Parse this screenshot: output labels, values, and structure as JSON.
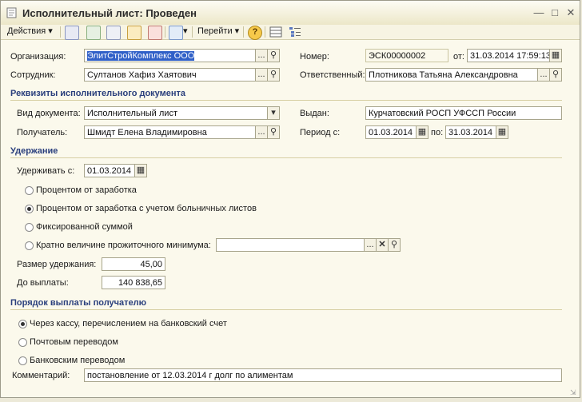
{
  "window": {
    "title": "Исполнительный лист: Проведен"
  },
  "toolbar": {
    "actions_label": "Действия",
    "goto_label": "Перейти",
    "icons": [
      "list-icon",
      "refresh-icon",
      "copy-icon",
      "post-icon",
      "unpost-icon",
      "move-icon",
      "help-icon",
      "table-icon",
      "structure-icon"
    ]
  },
  "header": {
    "org_label": "Организация:",
    "org_value": "ЭлитСтройКомплекс ООО",
    "employee_label": "Сотрудник:",
    "employee_value": "Султанов Хафиз Хаятович",
    "number_label": "Номер:",
    "number_value": "ЭСК00000002",
    "date_label": "от:",
    "date_value": "31.03.2014 17:59:13",
    "responsible_label": "Ответственный:",
    "responsible_value": "Плотникова Татьяна Александровна"
  },
  "doc_section": {
    "title": "Реквизиты исполнительного документа",
    "doc_type_label": "Вид документа:",
    "doc_type_value": "Исполнительный лист",
    "issued_label": "Выдан:",
    "issued_value": "Курчатовский РОСП УФССП России",
    "recipient_label": "Получатель:",
    "recipient_value": "Шмидт Елена Владимировна",
    "period_label": "Период с:",
    "period_from": "01.03.2014",
    "period_to_label": "по:",
    "period_to": "31.03.2014"
  },
  "deduction": {
    "title": "Удержание",
    "start_label": "Удерживать с:",
    "start_value": "01.03.2014",
    "options": [
      "Процентом от заработка",
      "Процентом от заработка с учетом больничных листов",
      "Фиксированной суммой",
      "Кратно величине прожиточного минимума:"
    ],
    "selected_index": 1,
    "amount_label": "Размер удержания:",
    "amount_value": "45,00",
    "remaining_label": "До выплаты:",
    "remaining_value": "140 838,65"
  },
  "payment": {
    "title": "Порядок выплаты получателю",
    "options": [
      "Через кассу, перечислением на банковский счет",
      "Почтовым переводом",
      "Банковским переводом"
    ],
    "selected_index": 0
  },
  "comment": {
    "label": "Комментарий:",
    "value": "постановление от 12.03.2014 г  долг по алиментам"
  }
}
